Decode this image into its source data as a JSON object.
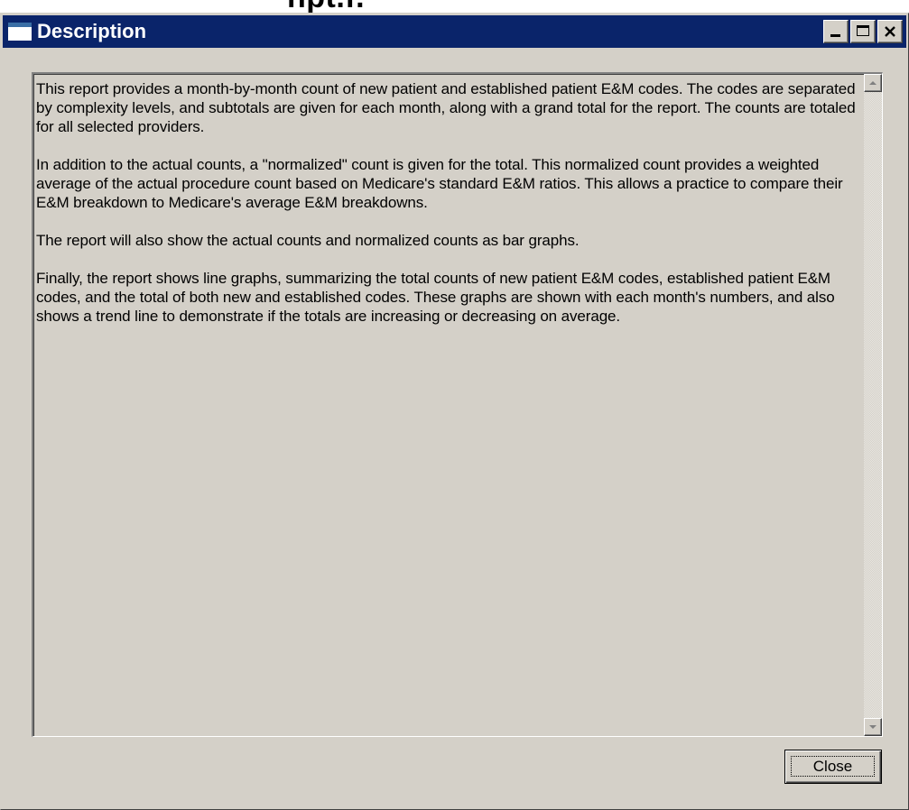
{
  "background": {
    "partial_title_text": "npt.f."
  },
  "window": {
    "title": "Description",
    "icon": "window-app-icon",
    "controls": {
      "minimize_icon": "minimize-icon",
      "maximize_icon": "maximize-icon",
      "close_icon": "close-icon"
    }
  },
  "description": {
    "paragraphs": [
      "This report provides a month-by-month count of new patient and established patient E&M codes. The codes are separated by complexity levels, and subtotals are given for each month, along with a grand total for the report.  The counts are totaled for all selected providers.",
      "In addition to the actual counts, a \"normalized\" count is given for the total.  This normalized count provides a weighted average of the actual procedure count based on Medicare's standard E&M ratios.  This allows a practice to compare their E&M breakdown to Medicare's average E&M breakdowns.",
      "The report will also show the actual counts and normalized counts as bar graphs.",
      "Finally, the report shows line graphs, summarizing the total counts of new patient E&M codes, established patient E&M codes, and the total of both new and established codes.  These graphs are shown with each month's numbers, and also shows a trend line to demonstrate if the totals are increasing or decreasing on average."
    ]
  },
  "scrollbar": {
    "up_icon": "scroll-up-arrow-icon",
    "down_icon": "scroll-down-arrow-icon"
  },
  "buttons": {
    "close_label": "Close"
  },
  "colors": {
    "titlebar": "#0a246a",
    "face": "#d4d0c8"
  }
}
